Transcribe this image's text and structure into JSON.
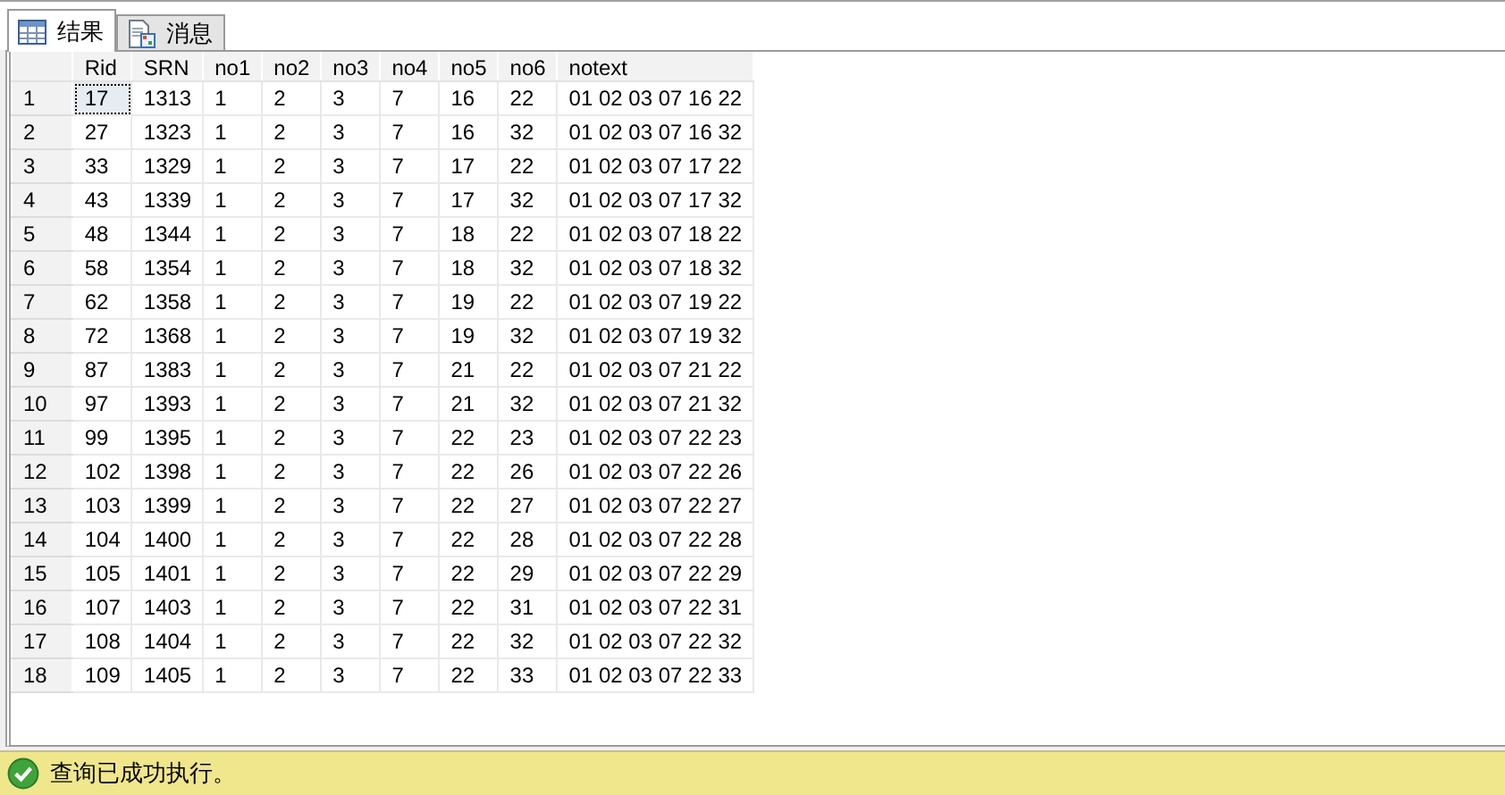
{
  "tabs": [
    {
      "label": "结果",
      "kind": "grid",
      "selected": true
    },
    {
      "label": "消息",
      "kind": "message",
      "selected": false
    }
  ],
  "table": {
    "columns": [
      "Rid",
      "SRN",
      "no1",
      "no2",
      "no3",
      "no4",
      "no5",
      "no6",
      "notext"
    ],
    "rows": [
      {
        "number": "1",
        "focused": true,
        "cells": [
          "17",
          "1313",
          "1",
          "2",
          "3",
          "7",
          "16",
          "22",
          "01 02 03 07 16 22"
        ]
      },
      {
        "number": "2",
        "focused": false,
        "cells": [
          "27",
          "1323",
          "1",
          "2",
          "3",
          "7",
          "16",
          "32",
          "01 02 03 07 16 32"
        ]
      },
      {
        "number": "3",
        "focused": false,
        "cells": [
          "33",
          "1329",
          "1",
          "2",
          "3",
          "7",
          "17",
          "22",
          "01 02 03 07 17 22"
        ]
      },
      {
        "number": "4",
        "focused": false,
        "cells": [
          "43",
          "1339",
          "1",
          "2",
          "3",
          "7",
          "17",
          "32",
          "01 02 03 07 17 32"
        ]
      },
      {
        "number": "5",
        "focused": false,
        "cells": [
          "48",
          "1344",
          "1",
          "2",
          "3",
          "7",
          "18",
          "22",
          "01 02 03 07 18 22"
        ]
      },
      {
        "number": "6",
        "focused": false,
        "cells": [
          "58",
          "1354",
          "1",
          "2",
          "3",
          "7",
          "18",
          "32",
          "01 02 03 07 18 32"
        ]
      },
      {
        "number": "7",
        "focused": false,
        "cells": [
          "62",
          "1358",
          "1",
          "2",
          "3",
          "7",
          "19",
          "22",
          "01 02 03 07 19 22"
        ]
      },
      {
        "number": "8",
        "focused": false,
        "cells": [
          "72",
          "1368",
          "1",
          "2",
          "3",
          "7",
          "19",
          "32",
          "01 02 03 07 19 32"
        ]
      },
      {
        "number": "9",
        "focused": false,
        "cells": [
          "87",
          "1383",
          "1",
          "2",
          "3",
          "7",
          "21",
          "22",
          "01 02 03 07 21 22"
        ]
      },
      {
        "number": "10",
        "focused": false,
        "cells": [
          "97",
          "1393",
          "1",
          "2",
          "3",
          "7",
          "21",
          "32",
          "01 02 03 07 21 32"
        ]
      },
      {
        "number": "11",
        "focused": false,
        "cells": [
          "99",
          "1395",
          "1",
          "2",
          "3",
          "7",
          "22",
          "23",
          "01 02 03 07 22 23"
        ]
      },
      {
        "number": "12",
        "focused": false,
        "cells": [
          "102",
          "1398",
          "1",
          "2",
          "3",
          "7",
          "22",
          "26",
          "01 02 03 07 22 26"
        ]
      },
      {
        "number": "13",
        "focused": false,
        "cells": [
          "103",
          "1399",
          "1",
          "2",
          "3",
          "7",
          "22",
          "27",
          "01 02 03 07 22 27"
        ]
      },
      {
        "number": "14",
        "focused": false,
        "cells": [
          "104",
          "1400",
          "1",
          "2",
          "3",
          "7",
          "22",
          "28",
          "01 02 03 07 22 28"
        ]
      },
      {
        "number": "15",
        "focused": false,
        "cells": [
          "105",
          "1401",
          "1",
          "2",
          "3",
          "7",
          "22",
          "29",
          "01 02 03 07 22 29"
        ]
      },
      {
        "number": "16",
        "focused": false,
        "cells": [
          "107",
          "1403",
          "1",
          "2",
          "3",
          "7",
          "22",
          "31",
          "01 02 03 07 22 31"
        ]
      },
      {
        "number": "17",
        "focused": false,
        "cells": [
          "108",
          "1404",
          "1",
          "2",
          "3",
          "7",
          "22",
          "32",
          "01 02 03 07 22 32"
        ]
      },
      {
        "number": "18",
        "focused": false,
        "cells": [
          "109",
          "1405",
          "1",
          "2",
          "3",
          "7",
          "22",
          "33",
          "01 02 03 07 22 33"
        ]
      }
    ]
  },
  "status_bar": {
    "text": "查询已成功执行。",
    "kind": "success"
  }
}
